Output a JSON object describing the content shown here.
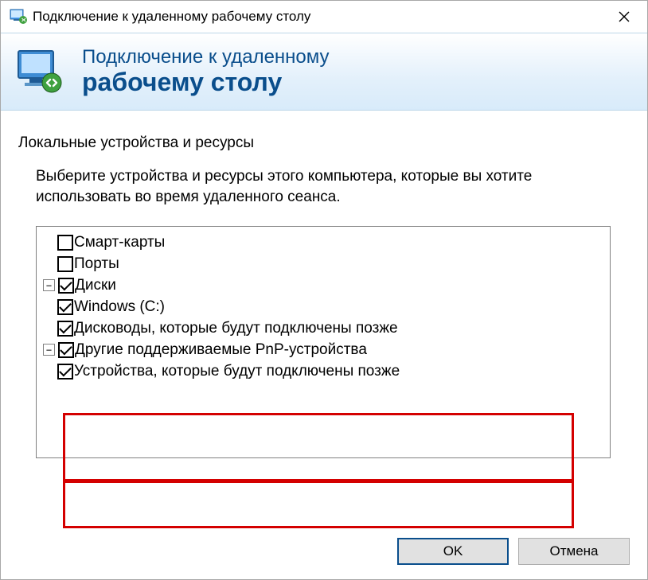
{
  "window": {
    "title": "Подключение к удаленному рабочему столу"
  },
  "banner": {
    "line1": "Подключение к удаленному",
    "line2": "рабочему столу"
  },
  "group": {
    "label": "Локальные устройства и ресурсы",
    "instruction": "Выберите устройства и ресурсы этого компьютера, которые вы хотите использовать во время удаленного сеанса."
  },
  "tree": {
    "smartcards": "Смарт-карты",
    "ports": "Порты",
    "drives": "Диски",
    "windows_c": "Windows (C:)",
    "later_drives": "Дисководы, которые будут подключены позже",
    "other_pnp": "Другие поддерживаемые PnP-устройства",
    "later_devices": "Устройства, которые будут подключены позже"
  },
  "buttons": {
    "ok": "OK",
    "cancel": "Отмена"
  }
}
